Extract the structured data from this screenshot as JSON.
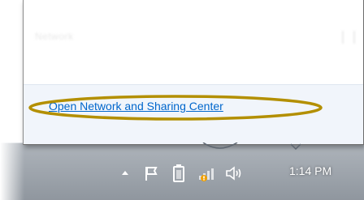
{
  "popup": {
    "network_name": "Network",
    "link_text": "Open Network and Sharing Center"
  },
  "tray": {
    "clock": "1:14 PM",
    "icons": [
      "show-hidden-icons-arrow",
      "action-center-flag-icon",
      "battery-icon",
      "network-warning-icon",
      "volume-icon"
    ]
  },
  "colors": {
    "link": "#0066cc",
    "highlight_ring": "#b38f00",
    "taskbar": "#979ea6",
    "footer": "#f1f5fb"
  }
}
